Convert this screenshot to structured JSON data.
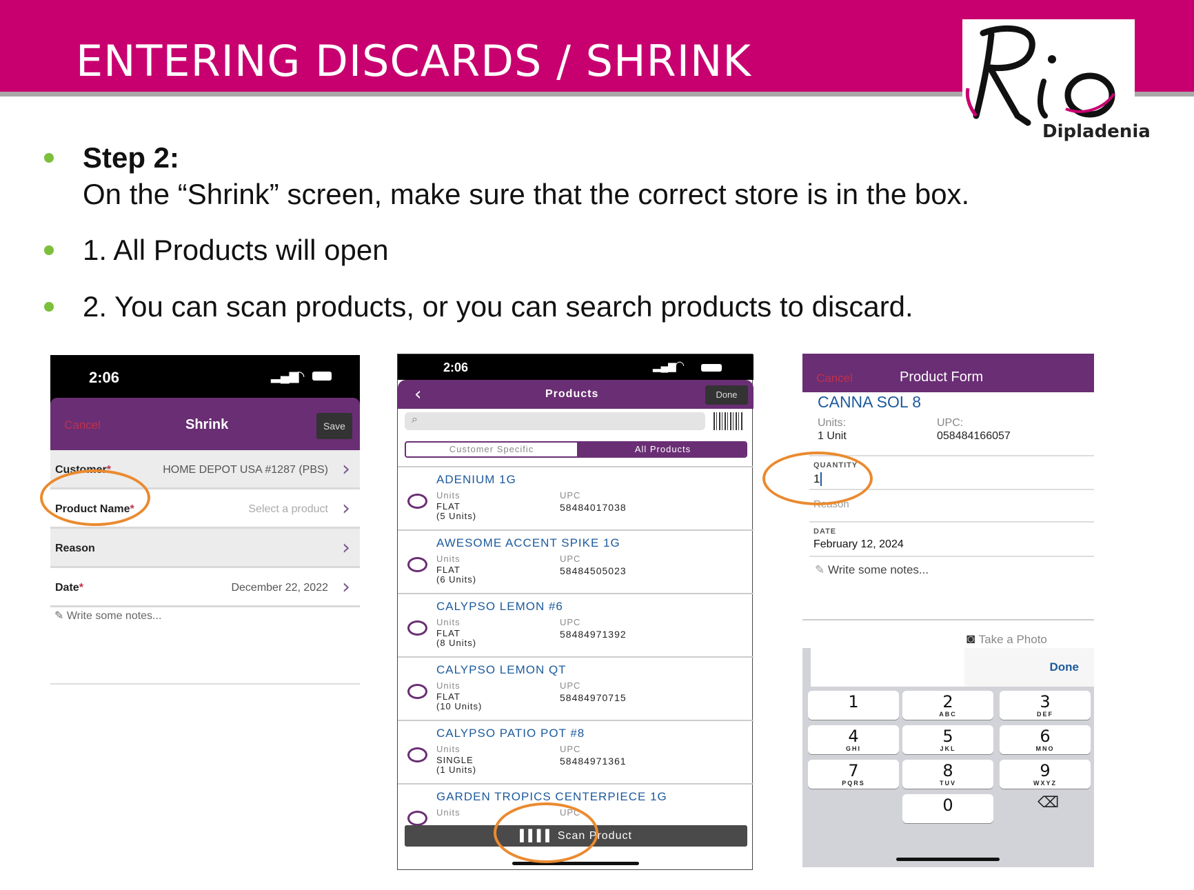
{
  "slide": {
    "title": "ENTERING DISCARDS / SHRINK",
    "logo_text": "Rio",
    "logo_subtext": "Dipladenia",
    "brand_color": "#c8006f",
    "accent_color": "#6a2e74",
    "bullets": {
      "step_label": "Step 2:",
      "step_text": "On the “Shrink” screen, make sure that the correct store is in the box.",
      "item1": "1. All Products will open",
      "item2": "2. You can scan products, or you can search products to discard."
    }
  },
  "screen1": {
    "time": "2:06",
    "cancel": "Cancel",
    "title": "Shrink",
    "save": "Save",
    "customer_label": "Customer",
    "customer_value": "HOME DEPOT USA #1287 (PBS)",
    "product_label": "Product Name",
    "product_placeholder": "Select a product",
    "reason_label": "Reason",
    "date_label": "Date",
    "date_value": "December 22, 2022",
    "notes": "Write some notes...",
    "required_mark": "*"
  },
  "screen2": {
    "time": "2:06",
    "title": "Products",
    "done": "Done",
    "tab_customer": "Customer Specific",
    "tab_all": "All Products",
    "units_label": "Units",
    "upc_label": "UPC",
    "products": [
      {
        "name": "ADENIUM 1G",
        "pack": "FLAT\n(5 Units)",
        "upc": "58484017038"
      },
      {
        "name": "AWESOME ACCENT SPIKE 1G",
        "pack": "FLAT\n(6 Units)",
        "upc": "58484505023"
      },
      {
        "name": "CALYPSO LEMON #6",
        "pack": "FLAT\n(8 Units)",
        "upc": "58484971392"
      },
      {
        "name": "CALYPSO LEMON QT",
        "pack": "FLAT\n(10 Units)",
        "upc": "58484970715"
      },
      {
        "name": "CALYPSO PATIO POT #8",
        "pack": "SINGLE\n(1 Units)",
        "upc": "58484971361"
      },
      {
        "name": "GARDEN TROPICS CENTERPIECE 1G",
        "pack": "",
        "upc": ""
      }
    ],
    "scan_button": "Scan Product"
  },
  "screen3": {
    "cancel": "Cancel",
    "title": "Product Form",
    "product_name": "CANNA SOL 8",
    "units_label": "Units:",
    "units_value": "1 Unit",
    "upc_label": "UPC:",
    "upc_value": "058484166057",
    "quantity_label": "QUANTITY",
    "quantity_value": "1",
    "reason_label": "Reason",
    "date_label": "DATE",
    "date_value": "February 12, 2024",
    "notes": "Write some notes...",
    "take_photo": "Take a Photo",
    "done": "Done",
    "keys": [
      {
        "d": "1",
        "l": ""
      },
      {
        "d": "2",
        "l": "ABC"
      },
      {
        "d": "3",
        "l": "DEF"
      },
      {
        "d": "4",
        "l": "GHI"
      },
      {
        "d": "5",
        "l": "JKL"
      },
      {
        "d": "6",
        "l": "MNO"
      },
      {
        "d": "7",
        "l": "PQRS"
      },
      {
        "d": "8",
        "l": "TUV"
      },
      {
        "d": "9",
        "l": "WXYZ"
      },
      {
        "d": "0",
        "l": ""
      }
    ]
  }
}
